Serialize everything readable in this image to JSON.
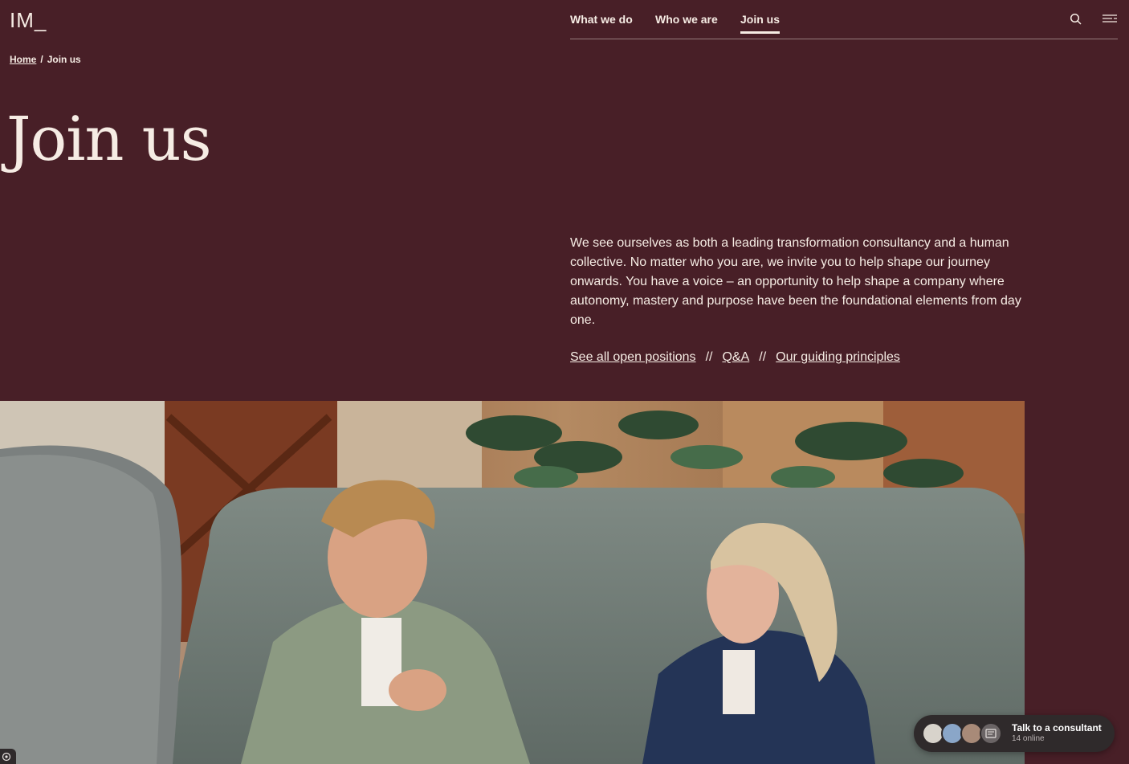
{
  "logo": "IM_",
  "nav": {
    "items": [
      {
        "label": "What we do",
        "active": false
      },
      {
        "label": "Who we are",
        "active": false
      },
      {
        "label": "Join us",
        "active": true
      }
    ],
    "search_icon": "search-icon",
    "menu_icon": "menu-icon"
  },
  "breadcrumb": {
    "home": "Home",
    "separator": "/",
    "current": "Join us"
  },
  "page_title": "Join us",
  "intro": "We see ourselves as both a leading transformation consultancy and a human collective. No matter who you are, we invite you to help shape our journey onwards. You have a voice – an opportunity to help shape a company where autonomy, mastery and purpose have been the foundational elements from day one.",
  "links": {
    "open_positions": "See all open positions",
    "qa": "Q&A",
    "principles": "Our guiding principles",
    "divider": "//"
  },
  "chat": {
    "title": "Talk to a consultant",
    "status": "14 online"
  },
  "colors": {
    "background": "#481f27",
    "text": "#f6ece4",
    "widget": "#2f2a2b"
  }
}
